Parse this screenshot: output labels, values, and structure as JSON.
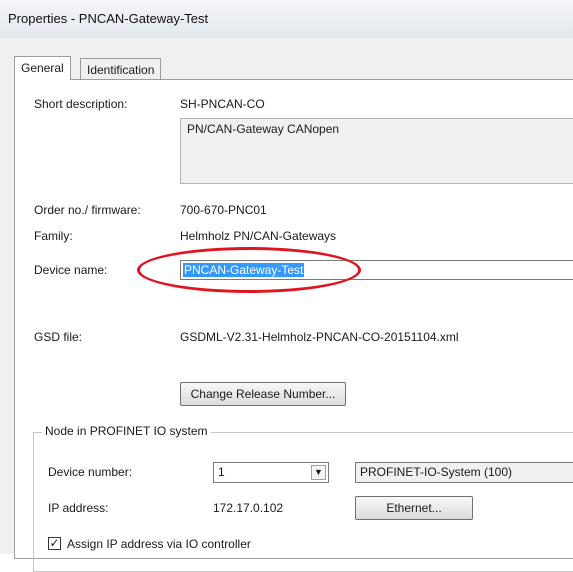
{
  "window": {
    "title": "Properties - PNCAN-Gateway-Test"
  },
  "tabs": [
    {
      "label": "General",
      "active": true
    },
    {
      "label": "Identification",
      "active": false
    }
  ],
  "general": {
    "short_description_label": "Short description:",
    "short_description_value": "SH-PNCAN-CO",
    "description_text": "PN/CAN-Gateway CANopen",
    "order_label": "Order no./ firmware:",
    "order_value": "700-670-PNC01",
    "family_label": "Family:",
    "family_value": "Helmholz PN/CAN-Gateways",
    "device_name_label": "Device name:",
    "device_name_value": "PNCAN-Gateway-Test",
    "gsd_label": "GSD file:",
    "gsd_value": "GSDML-V2.31-Helmholz-PNCAN-CO-20151104.xml",
    "change_release_button": "Change Release Number..."
  },
  "node_group": {
    "title": "Node in PROFINET IO system",
    "device_number_label": "Device number:",
    "device_number_value": "1",
    "io_system_value": "PROFINET-IO-System (100)",
    "ip_label": "IP address:",
    "ip_value": "172.17.0.102",
    "ethernet_button": "Ethernet...",
    "assign_ip_label": "Assign IP address via IO controller",
    "assign_ip_checked": true
  },
  "colors": {
    "highlight_ellipse": "#e0141e",
    "selection": "#3399ff"
  }
}
